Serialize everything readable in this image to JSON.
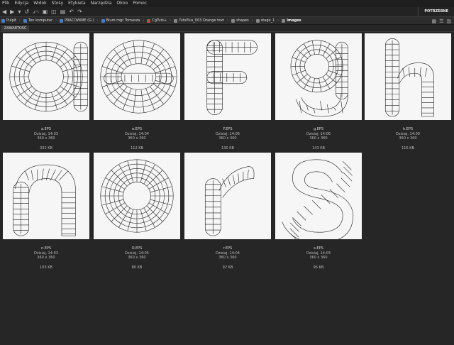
{
  "menu": [
    "Plik",
    "Edycja",
    "Widok",
    "Stosy",
    "Etykieta",
    "Narzędzia",
    "Okno",
    "Pomoc"
  ],
  "workspace": "POTRZEBNE",
  "breadcrumbs": [
    "Pulpit",
    "Ten komputer",
    "PRACOWNIE (G:)",
    "Biuro mgr Tomasza",
    "CgTuts+",
    "TutsPlus_003 Orange text",
    "shapes",
    "stage_1",
    "images"
  ],
  "panel_tab": "ZAWARTOŚĆ",
  "files": [
    {
      "name": "a.EPS",
      "date": "Dzisiaj, 14:03",
      "dims": "360 x 360",
      "size": "332 KB",
      "glyph": "a"
    },
    {
      "name": "e.EPS",
      "date": "Dzisiaj, 14:04",
      "dims": "360 x 360",
      "size": "112 KB",
      "glyph": "e"
    },
    {
      "name": "F.EPS",
      "date": "Dzisiaj, 14:06",
      "dims": "360 x 360",
      "size": "130 KB",
      "glyph": "F"
    },
    {
      "name": "g.EPS",
      "date": "Dzisiaj, 14:06",
      "dims": "360 x 360",
      "size": "143 KB",
      "glyph": "g"
    },
    {
      "name": "h.EPS",
      "date": "Dzisiaj, 14:00",
      "dims": "360 x 360",
      "size": "116 KB",
      "glyph": "h"
    },
    {
      "name": "n.EPS",
      "date": "Dzisiaj, 14:03",
      "dims": "360 x 360",
      "size": "103 KB",
      "glyph": "n"
    },
    {
      "name": "O.EPS",
      "date": "Dzisiaj, 14:05",
      "dims": "360 x 360",
      "size": "80 KB",
      "glyph": "o"
    },
    {
      "name": "r.EPS",
      "date": "Dzisiaj, 14:04",
      "dims": "360 x 360",
      "size": "92 KB",
      "glyph": "r"
    },
    {
      "name": "s.EPS",
      "date": "Dzisiaj, 14:03",
      "dims": "360 x 360",
      "size": "95 KB",
      "glyph": "s"
    }
  ]
}
